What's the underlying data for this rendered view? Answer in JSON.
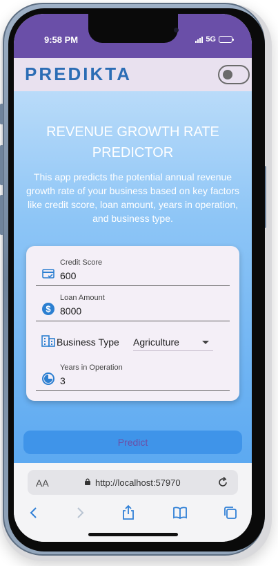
{
  "status_bar": {
    "time": "9:58 PM",
    "network": "5G"
  },
  "app_bar": {
    "brand": "PREDIKTA"
  },
  "main": {
    "title_line1": "REVENUE GROWTH RATE",
    "title_line2": "PREDICTOR",
    "description": "This app predicts the potential annual revenue growth rate of your business based on key factors like credit score, loan amount, years in operation, and business type."
  },
  "form": {
    "credit_score": {
      "label": "Credit Score",
      "value": "600",
      "icon": "credit-card-icon"
    },
    "loan_amount": {
      "label": "Loan Amount",
      "value": "8000",
      "icon": "dollar-icon"
    },
    "business_type": {
      "label": "Business Type",
      "value": "Agriculture",
      "icon": "building-icon"
    },
    "years_in_operation": {
      "label": "Years in Operation",
      "value": "3",
      "icon": "timer-icon"
    },
    "predict_label": "Predict"
  },
  "browser": {
    "aa_label": "AA",
    "url": "http://localhost:57970"
  },
  "colors": {
    "accent": "#2c6db5",
    "status_bar": "#6a4fa8",
    "button": "#3f94e9",
    "button_text": "#6c4ea5"
  }
}
